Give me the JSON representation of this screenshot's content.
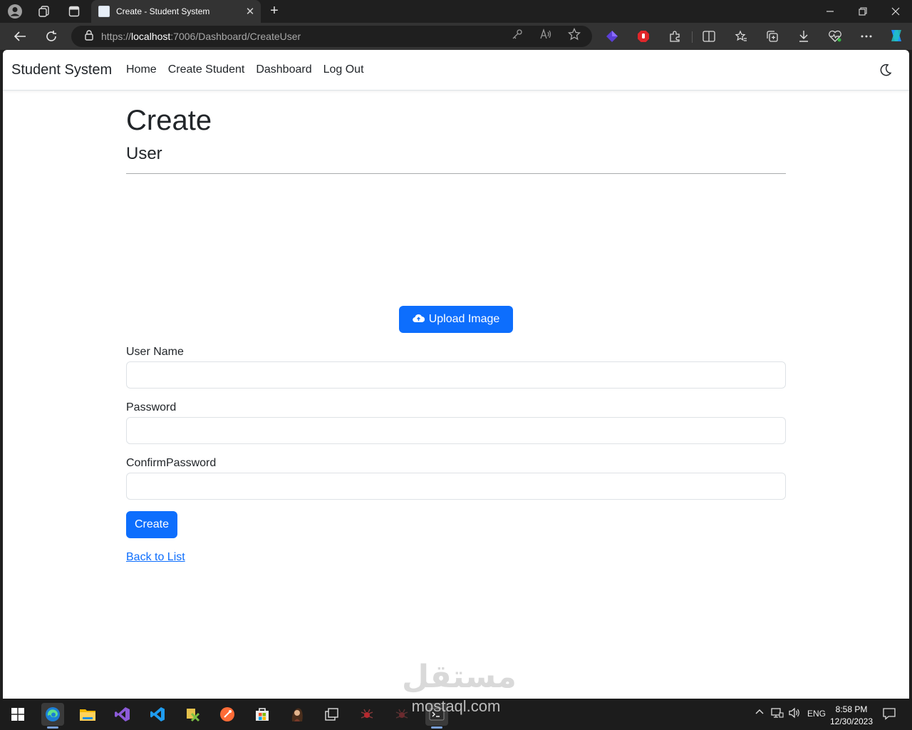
{
  "browser": {
    "tab_title": "Create - Student System",
    "url_scheme": "https://",
    "url_host": "localhost",
    "url_rest": ":7006/Dashboard/CreateUser",
    "accent": "#0d6efd"
  },
  "navbar": {
    "brand": "Student System",
    "links": [
      "Home",
      "Create Student",
      "Dashboard",
      "Log Out"
    ]
  },
  "page": {
    "title": "Create",
    "subtitle": "User",
    "upload_label": "Upload Image",
    "fields": [
      {
        "label": "User Name",
        "value": ""
      },
      {
        "label": "Password",
        "value": ""
      },
      {
        "label": "ConfirmPassword",
        "value": ""
      }
    ],
    "submit_label": "Create",
    "back_link": "Back to List"
  },
  "watermark": {
    "arabic": "مستقل",
    "latin": "mostaql.com"
  },
  "taskbar": {
    "language": "ENG",
    "time": "8:58 PM",
    "date": "12/30/2023"
  }
}
